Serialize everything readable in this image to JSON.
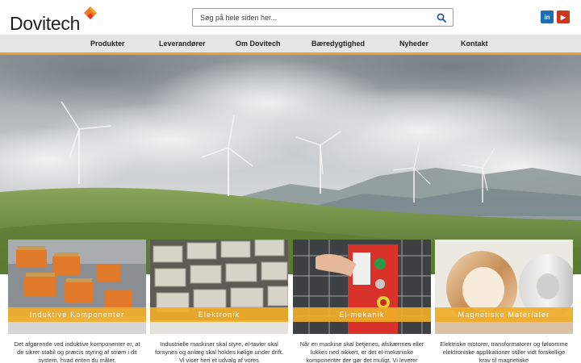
{
  "brand": {
    "name": "Dovitech",
    "accent": "#f0a023",
    "logo_orange": "#f07b1e",
    "logo_red": "#e0362a"
  },
  "search": {
    "placeholder": "Søg på hele siden her...",
    "value": ""
  },
  "social": {
    "linkedin": "in",
    "youtube": "▶"
  },
  "nav": {
    "items": [
      {
        "label": "Produkter"
      },
      {
        "label": "Leverandører"
      },
      {
        "label": "Om Dovitech"
      },
      {
        "label": "Bæredygtighed"
      },
      {
        "label": "Nyheder"
      },
      {
        "label": "Kontakt"
      }
    ]
  },
  "hero": {
    "image": "wind-turbines-landscape"
  },
  "cards": [
    {
      "title": "Induktive Komponenter",
      "text": "Det afgørende ved induktive komponenter er, at de sikrer stabil og præcis styring af strøm i dit system, hvad enten du måler,"
    },
    {
      "title": "Elektronik",
      "text": "Industrielle maskiner skal styre, el-tavler skal forsynes og anlæg skal holdes kølige under drift. Vi viser heri et udvalg af vores"
    },
    {
      "title": "El-mekanik",
      "text": "Når en maskine skal betjenes, afskærmes eller lukkes ned sikkert, er det el-mekaniske komponenter der gør det muligt. Vi leverer"
    },
    {
      "title": "Magnetiske Materialer",
      "text": "Elektriske motorer, transformatorer og følsomme elektroniske applikationer stiller vidt forskellige krav til magnetiske"
    }
  ]
}
